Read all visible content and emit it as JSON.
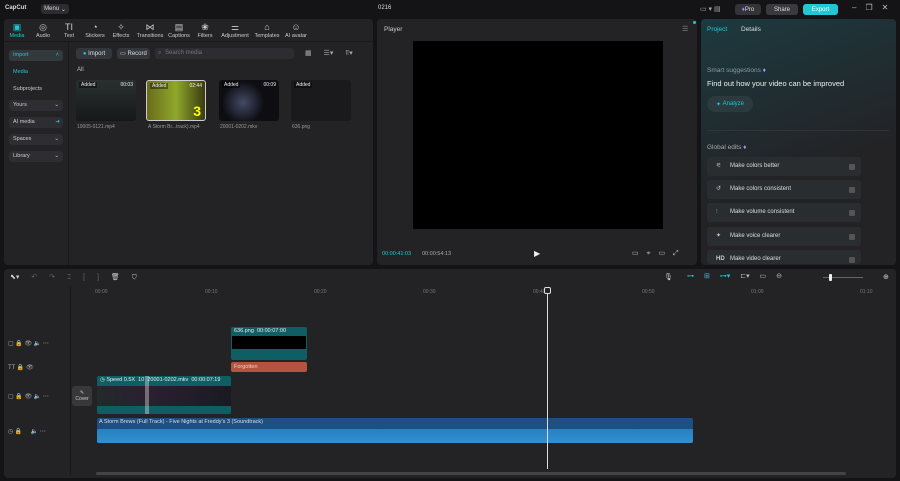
{
  "app": {
    "logo": "CapCut",
    "menu": "Menu",
    "project_name": "0216"
  },
  "topbar": {
    "pro": "Pro",
    "share": "Share",
    "export": "Export"
  },
  "toolbar": [
    {
      "label": "Media",
      "icon": "media-icon"
    },
    {
      "label": "Audio",
      "icon": "audio-icon"
    },
    {
      "label": "Text",
      "icon": "text-icon"
    },
    {
      "label": "Stickers",
      "icon": "stickers-icon"
    },
    {
      "label": "Effects",
      "icon": "effects-icon"
    },
    {
      "label": "Transitions",
      "icon": "transitions-icon"
    },
    {
      "label": "Captions",
      "icon": "captions-icon"
    },
    {
      "label": "Filters",
      "icon": "filters-icon"
    },
    {
      "label": "Adjustment",
      "icon": "adjustment-icon"
    },
    {
      "label": "Templates",
      "icon": "templates-icon"
    },
    {
      "label": "AI avatar",
      "icon": "ai-avatar-icon"
    }
  ],
  "sidebar": {
    "import": "Import",
    "media": "Media",
    "subprojects": "Subprojects",
    "yours": "Yours",
    "ai_media": "AI media",
    "spaces": "Spaces",
    "library": "Library"
  },
  "media": {
    "import_btn": "Import",
    "record_btn": "Record",
    "search_placeholder": "Search media",
    "filter_all": "All",
    "items": [
      {
        "badge": "Added",
        "duration": "00:03",
        "name": "10005-0121.mp4"
      },
      {
        "badge": "Added",
        "duration": "02:44",
        "name": "A Storm Br...track).mp4"
      },
      {
        "badge": "Added",
        "duration": "00:09",
        "name": "20001-0202.mkv"
      },
      {
        "badge": "Added",
        "duration": "",
        "name": "636.png"
      }
    ]
  },
  "player": {
    "title": "Player",
    "current_time": "00:00:41:03",
    "total_time": "00:00:54:13"
  },
  "right": {
    "tab_project": "Project",
    "tab_details": "Details",
    "smart_title": "Smart suggestions",
    "smart_headline": "Find out how your video can be improved",
    "analyze": "Analyze",
    "global_edits": "Global edits",
    "edits": [
      {
        "label": "Make colors better",
        "icon": "wand-icon"
      },
      {
        "label": "Make colors consistent",
        "icon": "color-match-icon"
      },
      {
        "label": "Make volume consistent",
        "icon": "volume-levels-icon"
      },
      {
        "label": "Make voice clearer",
        "icon": "sparkle-icon"
      },
      {
        "label": "Make video clearer",
        "icon": "HD"
      }
    ]
  },
  "timeline": {
    "ticks": [
      "00:00",
      "00:10",
      "00:20",
      "00:30",
      "00:40",
      "00:50",
      "01:00",
      "01:10"
    ],
    "overlay_clip": {
      "name": "636.png",
      "duration": "00:00:07:00"
    },
    "text_clip": "Forgotten",
    "main_clip": {
      "speed": "Speed 0.5X",
      "short": "10",
      "name": "20001-0202.mkv",
      "duration": "00:00:07:19"
    },
    "cover": "Cover",
    "audio_clip": "A Storm Brews (Full Track) - Five Nights at Freddy's 3 (Soundtrack)"
  },
  "colors": {
    "accent": "#1fc8d4",
    "clip": "#0e5e63",
    "text_clip": "#b5543e",
    "audio": "#1c4f82"
  }
}
